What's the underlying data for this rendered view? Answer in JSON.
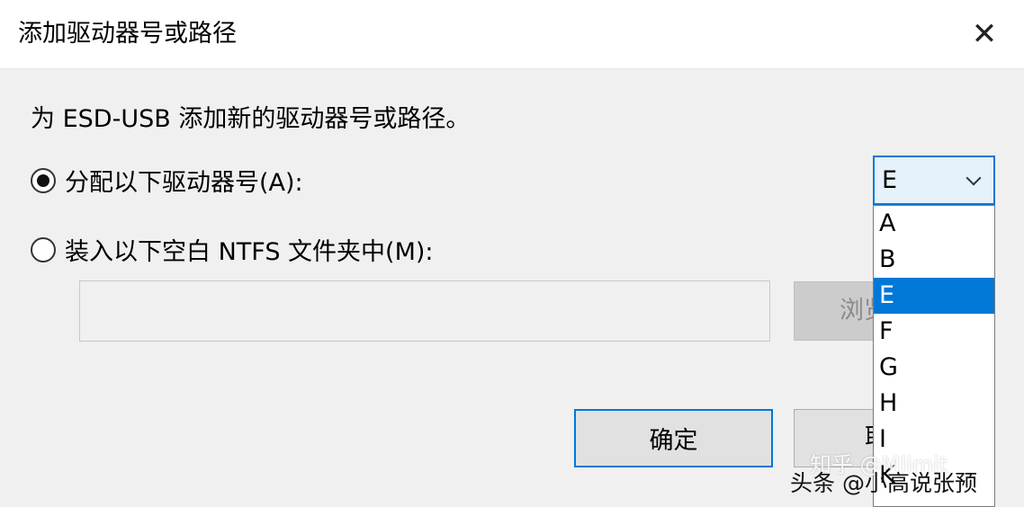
{
  "dialog": {
    "title": "添加驱动器号或路径",
    "close_glyph": "✕",
    "description": "为 ESD-USB 添加新的驱动器号或路径。",
    "assign_option": {
      "label": "分配以下驱动器号(A):",
      "checked": true
    },
    "mount_option": {
      "label": "装入以下空白 NTFS 文件夹中(M):",
      "checked": false
    },
    "path_input": {
      "value": "",
      "placeholder": ""
    },
    "browse_label": "浏览",
    "ok_label": "确定",
    "cancel_label": "取"
  },
  "drive_select": {
    "selected": "E",
    "options": [
      "A",
      "B",
      "E",
      "F",
      "G",
      "H",
      "I",
      "K"
    ]
  },
  "watermarks": {
    "zhihu": "知乎 @Mlimit",
    "toutiao": "头条 @小高说张预"
  },
  "colors": {
    "accent": "#0078d7",
    "selected_bg": "#0078d7",
    "combo_bg": "#e5f1fb"
  }
}
